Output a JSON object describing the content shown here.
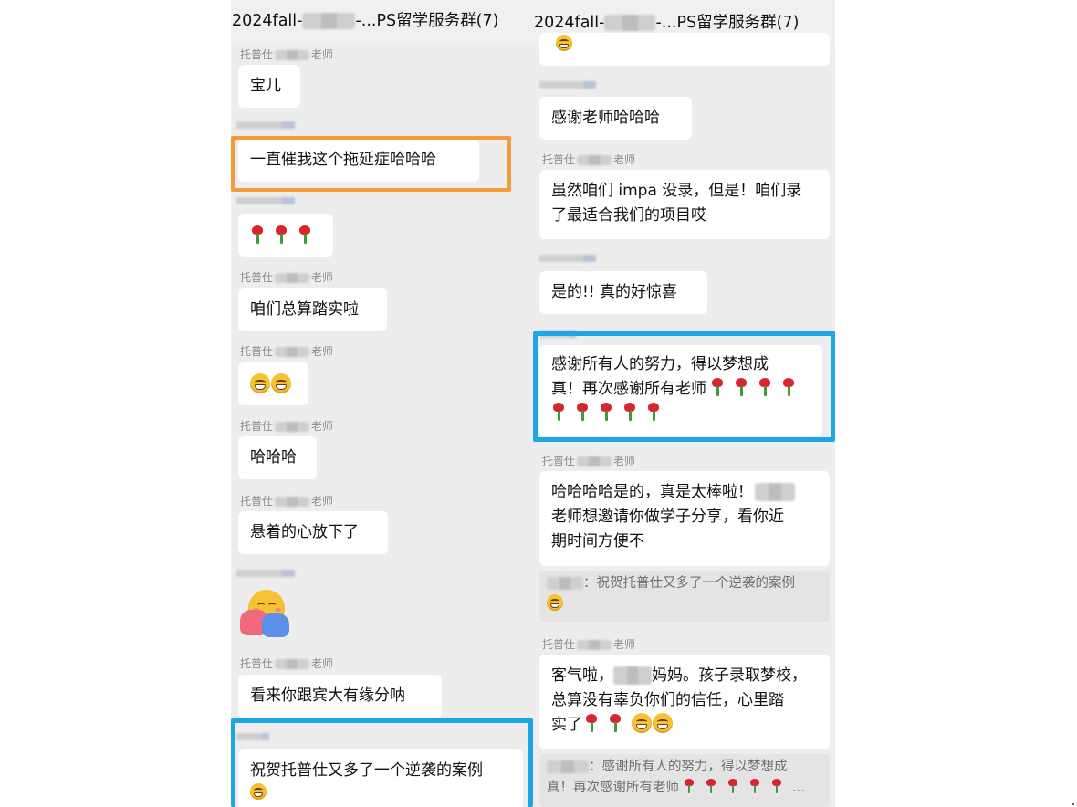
{
  "left_panel": {
    "title": "2024fall-",
    "title_suffix": "-...PS留学服务群(7)",
    "messages": [
      {
        "sender_prefix": "托普仕",
        "sender_suffix": "老师",
        "text": "宝儿"
      },
      {
        "text": "一直催我这个拖延症哈哈哈"
      },
      {
        "roses": 3
      },
      {
        "sender_prefix": "托普仕",
        "sender_suffix": "老师",
        "text": "咱们总算踏实啦"
      },
      {
        "sender_prefix": "托普仕",
        "sender_suffix": "老师",
        "emoji": "grin-face-x2"
      },
      {
        "sender_prefix": "托普仕",
        "sender_suffix": "老师",
        "text": "哈哈哈"
      },
      {
        "sender_prefix": "托普仕",
        "sender_suffix": "老师",
        "text": "悬着的心放下了"
      },
      {
        "emoji": "hug-face"
      },
      {
        "sender_prefix": "托普仕",
        "sender_suffix": "老师",
        "text": "看来你跟宾大有缘分呐"
      },
      {
        "text": "祝贺托普仕又多了一个逆袭的案例"
      }
    ]
  },
  "right_panel": {
    "title": "2024fall-",
    "title_suffix": "-...PS留学服务群(7)",
    "messages": [
      {
        "text": "感谢老师哈哈哈"
      },
      {
        "sender_prefix": "托普仕",
        "sender_suffix": "老师",
        "lines": [
          "虽然咱们 impa 没录，但是！咱们录",
          "了最适合我们的项目哎"
        ]
      },
      {
        "text": "是的!! 真的好惊喜"
      },
      {
        "lines": [
          "感谢所有人的努力，得以梦想成",
          "真！再次感谢所有老师"
        ],
        "roses_line2": 4,
        "roses_line3": 5
      },
      {
        "sender_prefix": "托普仕",
        "sender_suffix": "老师",
        "lines": [
          "哈哈哈哈是的，真是太棒啦！",
          "老师想邀请你做学子分享，看你近",
          "期时间方便不"
        ]
      },
      {
        "quote": "：祝贺托普仕又多了一个逆袭的案例"
      },
      {
        "sender_prefix": "托普仕",
        "sender_suffix": "老师",
        "line1_prefix": "客气啦，",
        "line1_suffix": "妈妈。孩子录取梦校，",
        "line2": "总算没有辜负你们的信任，心里踏",
        "line3": "实了"
      },
      {
        "quote_line1": "：感谢所有人的努力，得以梦想成",
        "quote_line2": "真！再次感谢所有老师",
        "quote_ellipsis": "..."
      }
    ]
  },
  "colors": {
    "chat_background": "#ededed",
    "bubble": "#ffffff",
    "highlight_orange": "#f39a3a",
    "highlight_blue": "#1fa4e6"
  }
}
